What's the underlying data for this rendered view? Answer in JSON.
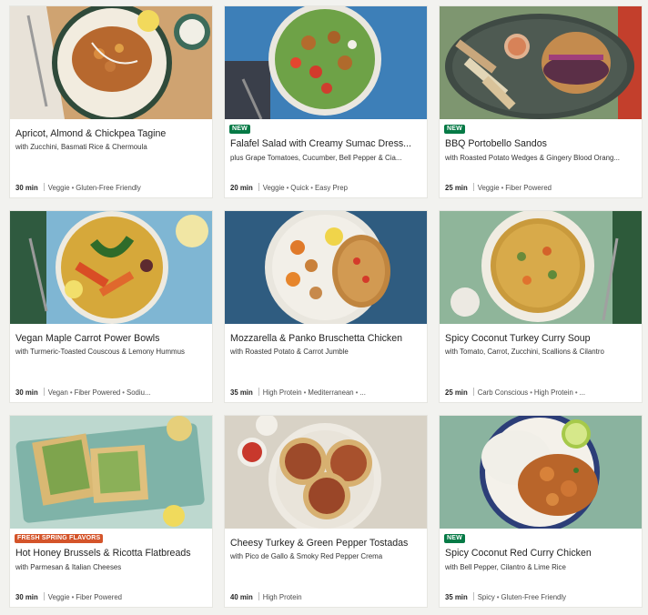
{
  "colors": {
    "new_badge": "#067a46",
    "promo_badge": "#d4542a",
    "card_bg": "#ffffff",
    "page_bg": "#f2f2ef"
  },
  "recipes": [
    {
      "title": "Apricot, Almond & Chickpea Tagine",
      "subtitle": "with Zucchini, Basmati Rice & Chermoula",
      "time": "30 min",
      "tags": [
        "Veggie",
        "Gluten-Free Friendly"
      ],
      "badge": ""
    },
    {
      "title": "Falafel Salad with Creamy Sumac Dress...",
      "subtitle": "plus Grape Tomatoes, Cucumber, Bell Pepper & Cia...",
      "time": "20 min",
      "tags": [
        "Veggie",
        "Quick",
        "Easy Prep"
      ],
      "badge": "NEW"
    },
    {
      "title": "BBQ Portobello Sandos",
      "subtitle": "with Roasted Potato Wedges & Gingery Blood Orang...",
      "time": "25 min",
      "tags": [
        "Veggie",
        "Fiber Powered"
      ],
      "badge": "NEW"
    },
    {
      "title": "Vegan Maple Carrot Power Bowls",
      "subtitle": "with Turmeric-Toasted Couscous & Lemony Hummus",
      "time": "30 min",
      "tags": [
        "Vegan",
        "Fiber Powered",
        "Sodiu..."
      ],
      "badge": ""
    },
    {
      "title": "Mozzarella & Panko Bruschetta Chicken",
      "subtitle": "with Roasted Potato & Carrot Jumble",
      "time": "35 min",
      "tags": [
        "High Protein",
        "Mediterranean",
        "..."
      ],
      "badge": ""
    },
    {
      "title": "Spicy Coconut Turkey Curry Soup",
      "subtitle": "with Tomato, Carrot, Zucchini, Scallions & Cilantro",
      "time": "25 min",
      "tags": [
        "Carb Conscious",
        "High Protein",
        "..."
      ],
      "badge": ""
    },
    {
      "title": "Hot Honey Brussels & Ricotta Flatbreads",
      "subtitle": "with Parmesan & Italian Cheeses",
      "time": "30 min",
      "tags": [
        "Veggie",
        "Fiber Powered"
      ],
      "badge": "FRESH SPRING FLAVORS"
    },
    {
      "title": "Cheesy Turkey & Green Pepper Tostadas",
      "subtitle": "with Pico de Gallo & Smoky Red Pepper Crema",
      "time": "40 min",
      "tags": [
        "High Protein"
      ],
      "badge": ""
    },
    {
      "title": "Spicy Coconut Red Curry Chicken",
      "subtitle": "with Bell Pepper, Cilantro & Lime Rice",
      "time": "35 min",
      "tags": [
        "Spicy",
        "Gluten-Free Friendly"
      ],
      "badge": "NEW"
    }
  ]
}
